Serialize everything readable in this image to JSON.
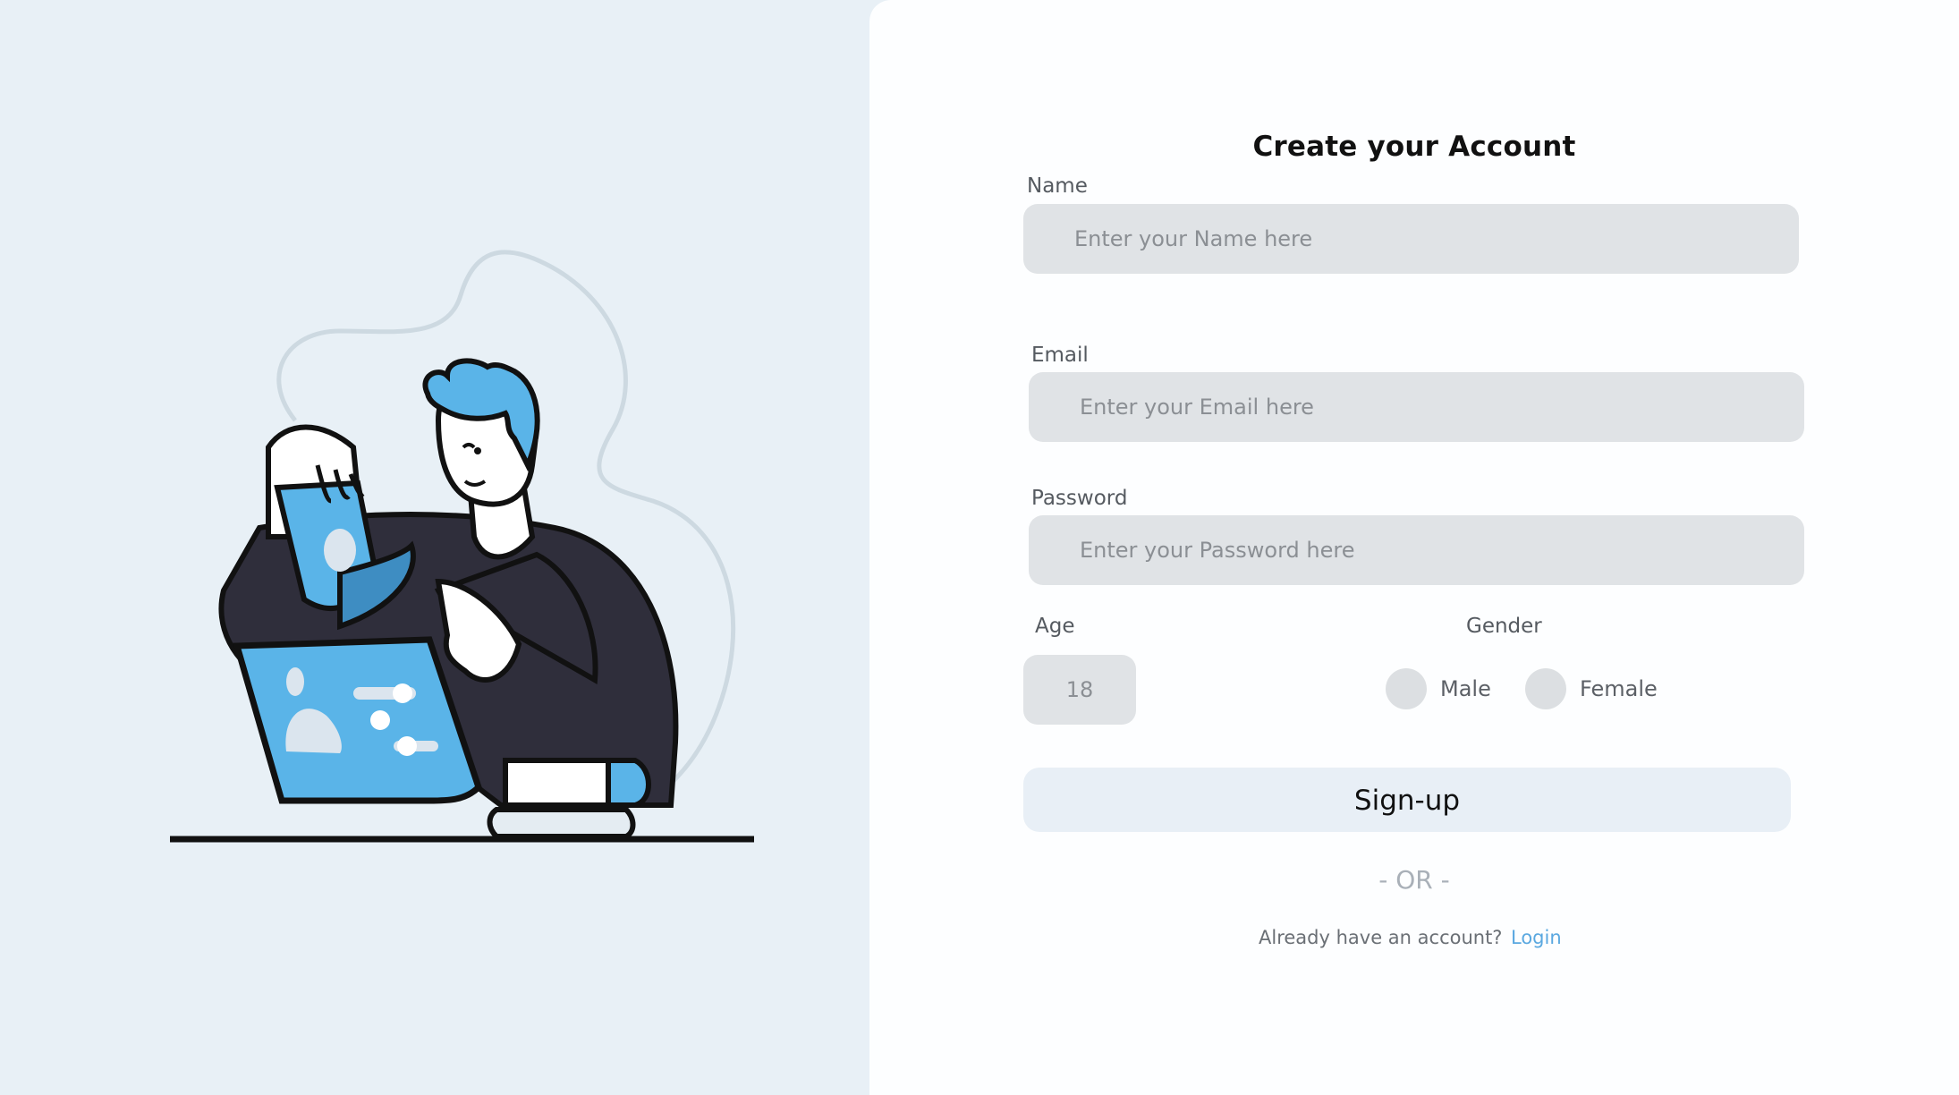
{
  "title": "Create your Account",
  "name": {
    "label": "Name",
    "placeholder": "Enter your Name here"
  },
  "email": {
    "label": "Email",
    "placeholder": "Enter your Email here"
  },
  "password": {
    "label": "Password",
    "placeholder": "Enter your Password here"
  },
  "age": {
    "label": "Age",
    "placeholder": "18"
  },
  "gender": {
    "label": "Gender",
    "options": [
      "Male",
      "Female"
    ]
  },
  "signup_label": "Sign-up",
  "or_text": "- OR -",
  "login_prompt": "Already have an account?",
  "login_link": "Login",
  "colors": {
    "accent": "#5aa8e0",
    "left_bg": "#e8f0f6",
    "field_bg": "#e0e3e6"
  }
}
